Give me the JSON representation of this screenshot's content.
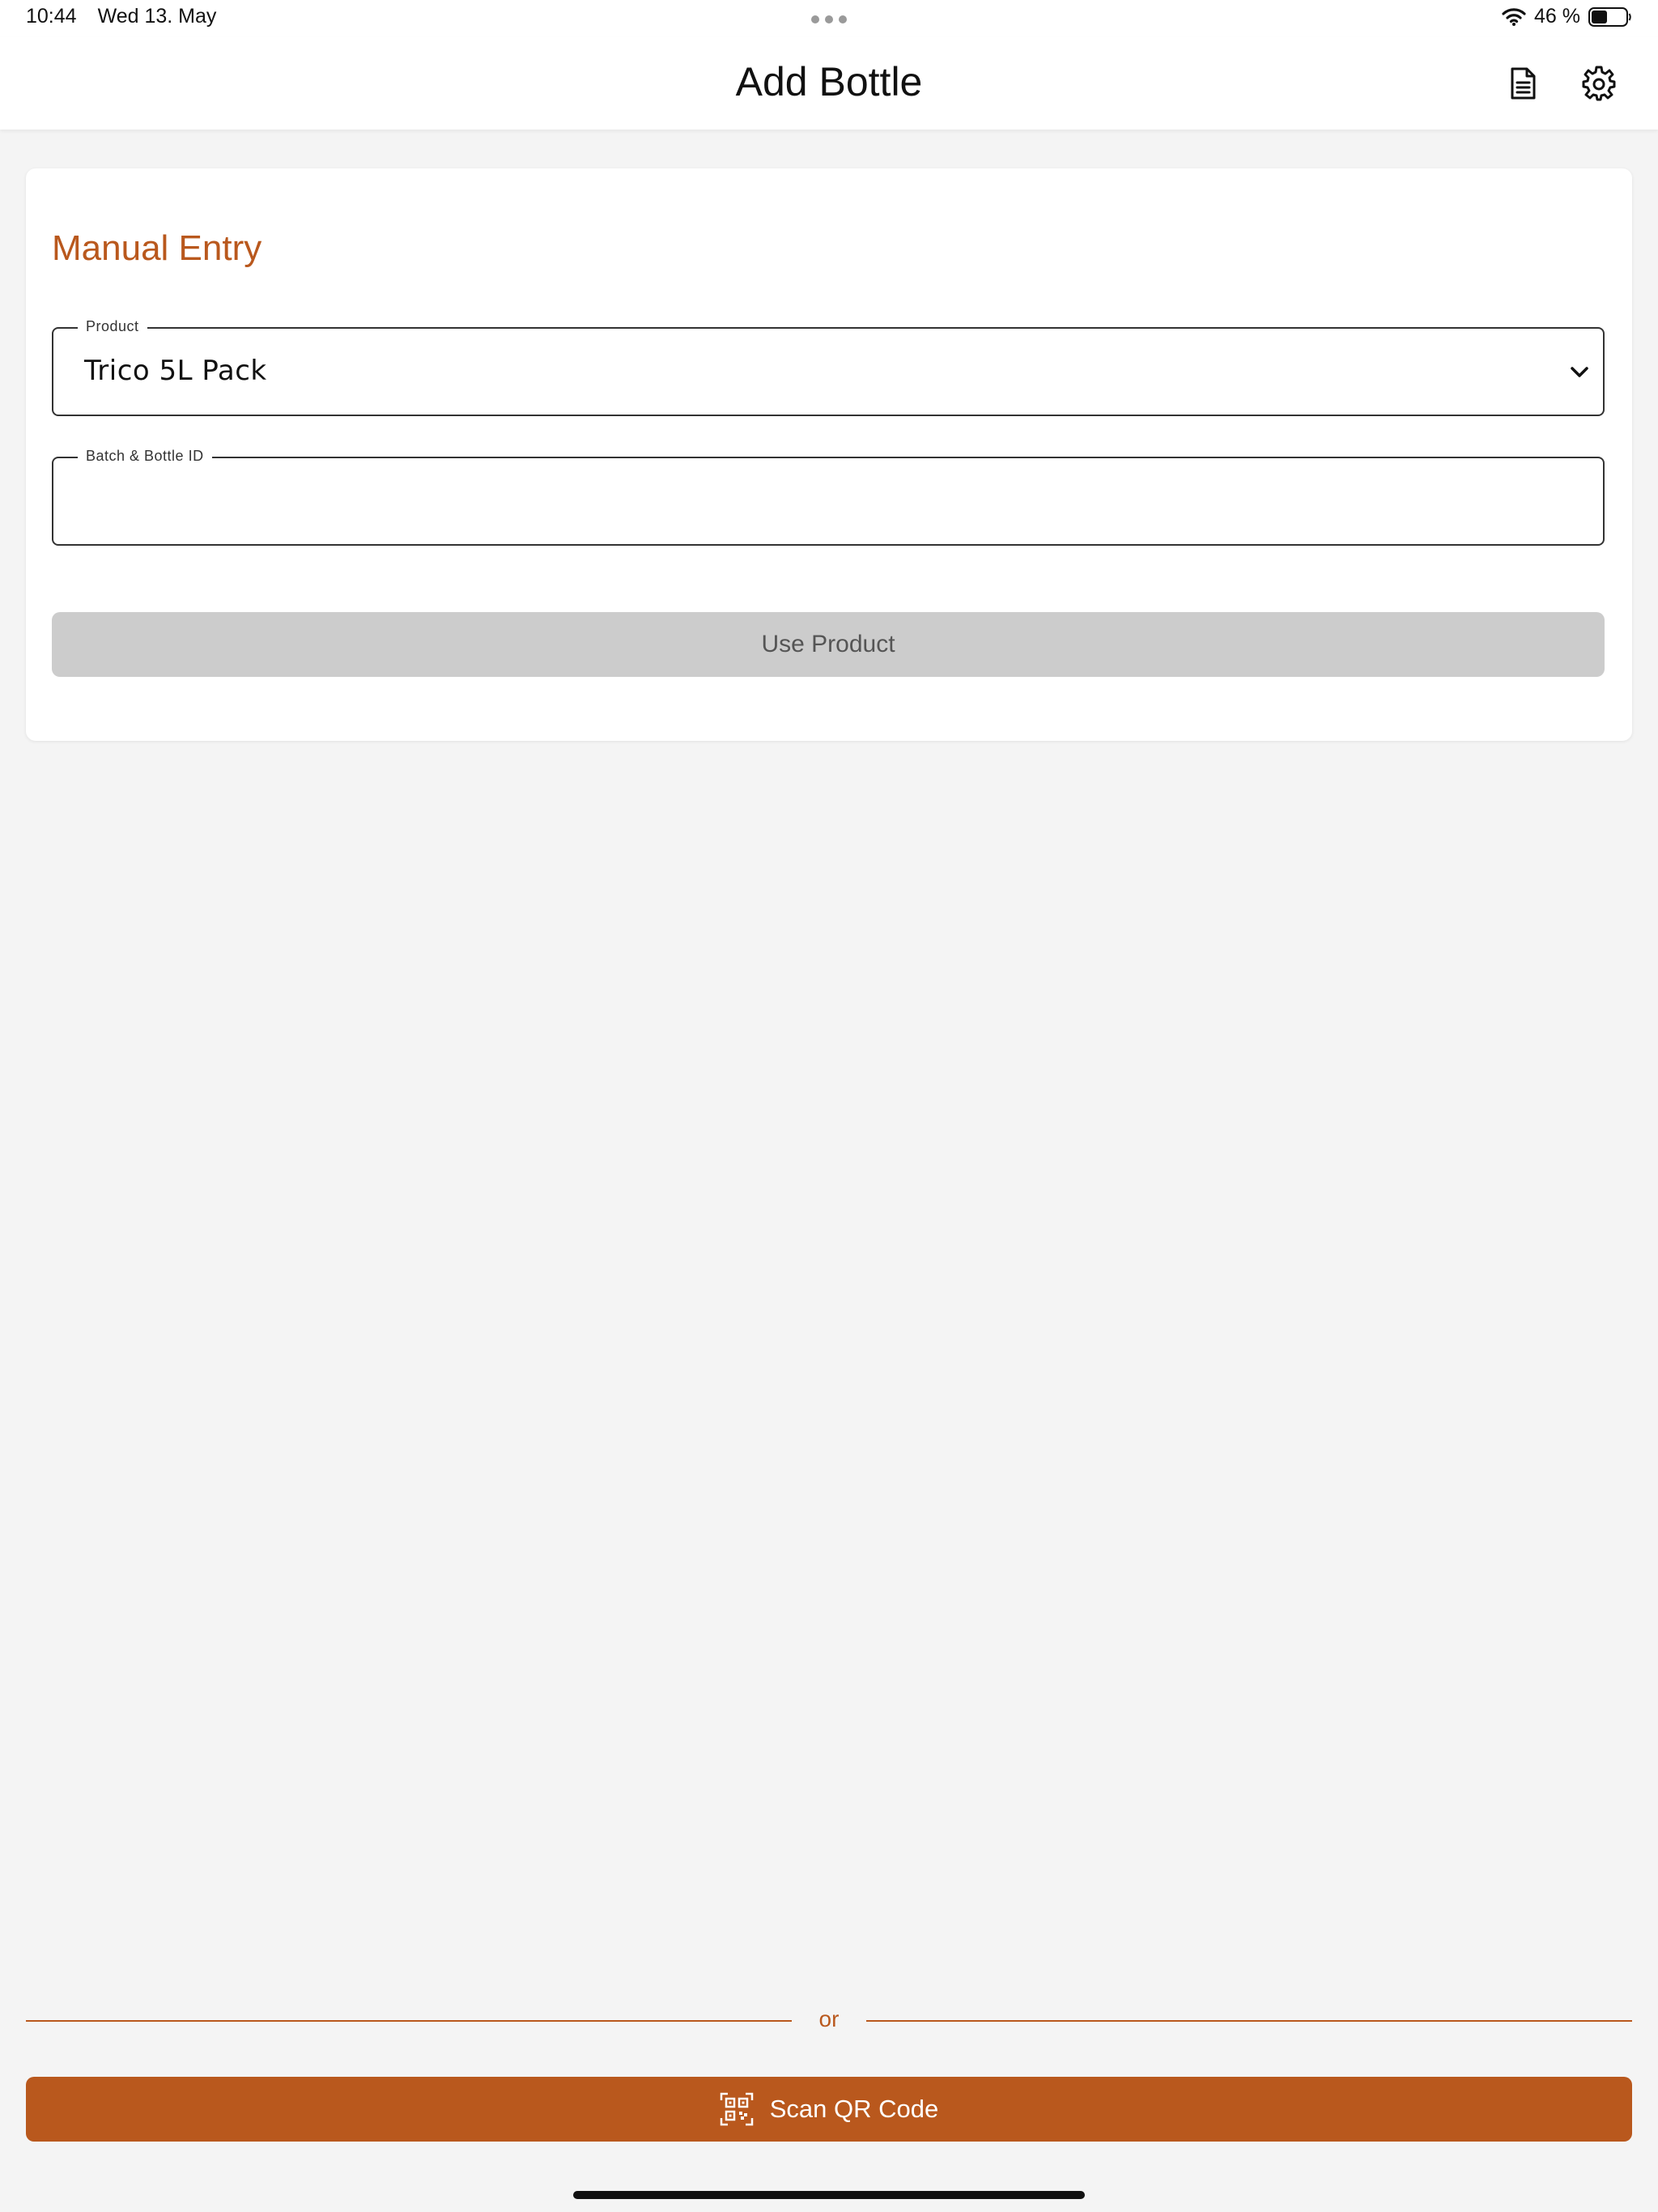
{
  "status_bar": {
    "time": "10:44",
    "date": "Wed 13. May",
    "battery": "46 %"
  },
  "header": {
    "title": "Add Bottle",
    "icons": [
      "document-icon",
      "gear-icon"
    ]
  },
  "manual_entry": {
    "title": "Manual Entry",
    "product": {
      "label": "Product",
      "value": "Trico 5L Pack"
    },
    "batch": {
      "label": "Batch & Bottle ID",
      "value": ""
    },
    "use_button": "Use Product"
  },
  "divider": {
    "text": "or"
  },
  "scan_button": {
    "label": "Scan QR Code",
    "icon": "qr-code-icon"
  },
  "colors": {
    "accent": "#b9581d",
    "background": "#f4f4f4",
    "disabled_button": "#cccccc"
  }
}
